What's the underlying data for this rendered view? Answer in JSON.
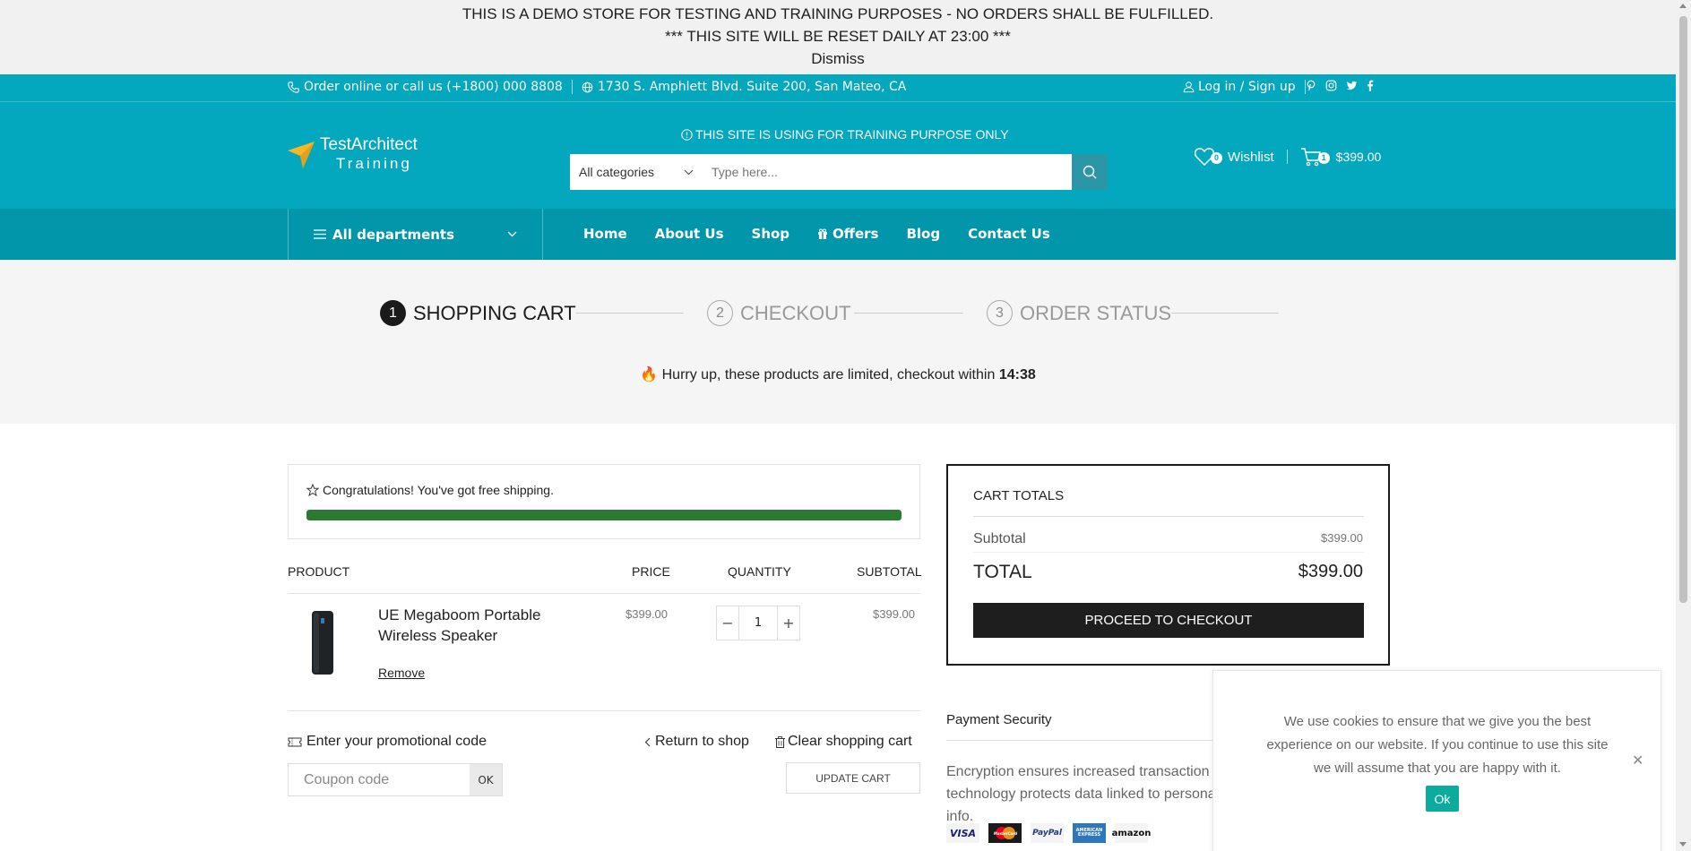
{
  "demo_banner": {
    "line1": "THIS IS A DEMO STORE FOR TESTING AND TRAINING PURPOSES - NO ORDERS SHALL BE FULFILLED.",
    "line2": "*** THIS SITE WILL BE RESET DAILY AT 23:00 ***",
    "dismiss": "Dismiss"
  },
  "topbar": {
    "phone_text": "Order online or call us (+1800) 000 8808",
    "address_text": "1730 S. Amphlett Blvd. Suite 200, San Mateo, CA",
    "login_text": "Log in / Sign up",
    "socials": [
      "pinterest-icon",
      "instagram-icon",
      "twitter-icon",
      "facebook-icon"
    ]
  },
  "header": {
    "logo_line1": "TestArchitect",
    "logo_line2": "Training",
    "training_notice": "THIS SITE IS USING FOR TRAINING PURPOSE ONLY",
    "search_category": "All categories",
    "search_placeholder": "Type here...",
    "wishlist_count": "0",
    "wishlist_label": "Wishlist",
    "cart_count": "1",
    "cart_total": "$399.00"
  },
  "nav": {
    "departments": "All departments",
    "links": [
      "Home",
      "About Us",
      "Shop",
      "Offers",
      "Blog",
      "Contact Us"
    ]
  },
  "steps": {
    "items": [
      {
        "num": "1",
        "label": "SHOPPING CART"
      },
      {
        "num": "2",
        "label": "CHECKOUT"
      },
      {
        "num": "3",
        "label": "ORDER STATUS"
      }
    ],
    "hurry_text": "Hurry up, these products are limited, checkout within",
    "timer": "14:38"
  },
  "shipping": {
    "message": "Congratulations! You've got free shipping.",
    "progress": 1.0
  },
  "cart": {
    "headers": {
      "product": "PRODUCT",
      "price": "PRICE",
      "quantity": "QUANTITY",
      "subtotal": "SUBTOTAL"
    },
    "items": [
      {
        "name": "UE Megaboom Portable Wireless Speaker",
        "price": "$399.00",
        "qty": "1",
        "subtotal": "$399.00",
        "remove": "Remove"
      }
    ],
    "promo_title": "Enter your promotional code",
    "coupon_placeholder": "Coupon code",
    "coupon_ok": "OK",
    "return_label": "Return to shop",
    "clear_label": "Clear shopping cart",
    "update_label": "UPDATE CART"
  },
  "totals": {
    "title": "CART TOTALS",
    "subtotal_label": "Subtotal",
    "subtotal_value": "$399.00",
    "total_label": "TOTAL",
    "total_value": "$399.00",
    "checkout_label": "PROCEED TO CHECKOUT"
  },
  "payment": {
    "title": "Payment Security",
    "text": "Encryption ensures increased transaction security. SSL technology protects data linked to personal and payment info.",
    "logos": [
      "VISA",
      "MasterCard",
      "PayPal",
      "AMERICAN EXPRESS",
      "amazon"
    ]
  },
  "cookie": {
    "text": "We use cookies to ensure that we give you the best experience on our website. If you continue to use this site we will assume that you are happy with it.",
    "ok": "Ok"
  },
  "colors": {
    "brand_teal": "#03a7be",
    "nav_teal": "#0296ab",
    "progress_green": "#2c7a32",
    "cookie_ok": "#0bab9e"
  }
}
